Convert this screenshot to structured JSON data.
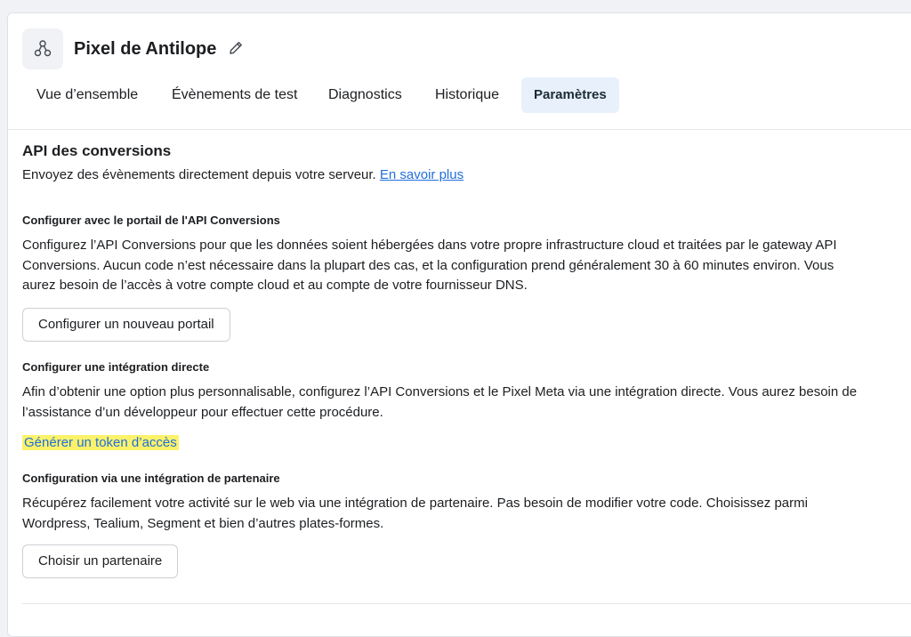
{
  "header": {
    "title": "Pixel de Antilope",
    "icon": "pixel-nodes-icon",
    "edit_icon": "pencil-icon"
  },
  "tabs": [
    {
      "label": "Vue d’ensemble",
      "active": false
    },
    {
      "label": "Évènements de test",
      "active": false
    },
    {
      "label": "Diagnostics",
      "active": false
    },
    {
      "label": "Historique",
      "active": false
    },
    {
      "label": "Paramètres",
      "active": true
    }
  ],
  "section": {
    "title": "API des conversions",
    "description": "Envoyez des évènements directement depuis votre serveur.",
    "learn_more": "En savoir plus"
  },
  "gateway": {
    "heading": "Configurer avec le portail de l'API Conversions",
    "text": "Configurez l’API Conversions pour que les données soient hébergées dans votre propre infrastructure cloud et traitées par le gateway API Conversions. Aucun code n’est nécessaire dans la plupart des cas, et la configuration prend généralement 30 à 60 minutes environ. Vous aurez besoin de l’accès à votre compte cloud et au compte de votre fournisseur DNS.",
    "button": "Configurer un nouveau portail"
  },
  "direct": {
    "heading": "Configurer une intégration directe",
    "text": "Afin d’obtenir une option plus personnalisable, configurez l’API Conversions et le Pixel Meta via une intégration directe. Vous aurez besoin de l’assistance d’un développeur pour effectuer cette procédure.",
    "link": "Générer un token d’accès"
  },
  "partner": {
    "heading": "Configuration via une intégration de partenaire",
    "text": "Récupérez facilement votre activité sur le web via une intégration de partenaire. Pas besoin de modifier votre code. Choisissez parmi Wordpress, Tealium, Segment et bien d’autres plates-formes.",
    "button": "Choisir un partenaire"
  },
  "colors": {
    "link": "#216fdb",
    "active_tab_bg": "#e7f0fb",
    "highlight": "#fbf26a"
  }
}
